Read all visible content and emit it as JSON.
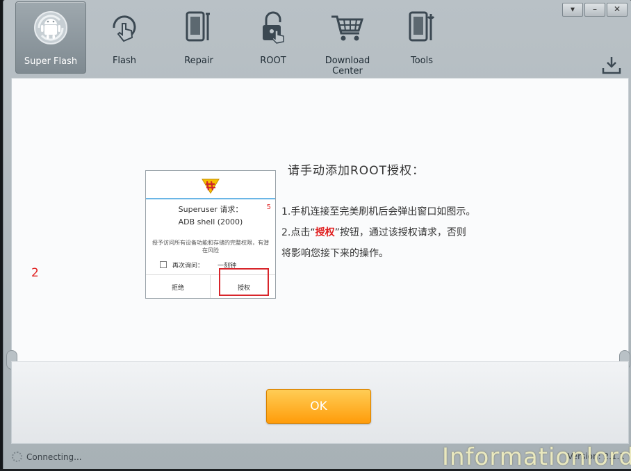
{
  "window": {
    "buttons": [
      "▾",
      "–",
      "✕"
    ]
  },
  "toolbar": {
    "items": [
      {
        "label": "Super Flash",
        "icon": "android-icon",
        "active": true
      },
      {
        "label": "Flash",
        "icon": "flash-gesture-icon",
        "active": false
      },
      {
        "label": "Repair",
        "icon": "repair-icon",
        "active": false
      },
      {
        "label": "ROOT",
        "icon": "lock-icon",
        "active": false
      },
      {
        "label": "Download Center",
        "icon": "cart-icon",
        "active": false
      },
      {
        "label": "Tools",
        "icon": "tools-icon",
        "active": false
      }
    ],
    "download_icon": "download-icon"
  },
  "content": {
    "side_number": "2",
    "heading": "请手动添加ROOT授权：",
    "step1": "1.手机连接至完美刷机后会弹出窗口如图示。",
    "step2_prefix": "2.点击“",
    "step2_highlight": "授权",
    "step2_suffix": "”按钮，通过该授权请求，否则",
    "step3": "将影响您接下来的操作。",
    "phone": {
      "title": "Superuser 请求：",
      "badge": "5",
      "adb": "ADB shell (2000)",
      "description": "授予访问所有设备功能和存储的完整权限，有潜在风险",
      "ask_again": "再次询问：",
      "duration": "一刻钟",
      "deny": "拒绝",
      "grant": "授权"
    }
  },
  "footer": {
    "ok_label": "OK",
    "status": "Connecting...",
    "version": "Version: 2.1.1",
    "watermark": "Informationlord"
  },
  "colors": {
    "accent_orange": "#ff9c0a",
    "highlight_red": "#e02020",
    "panel": "#fafbfc"
  }
}
